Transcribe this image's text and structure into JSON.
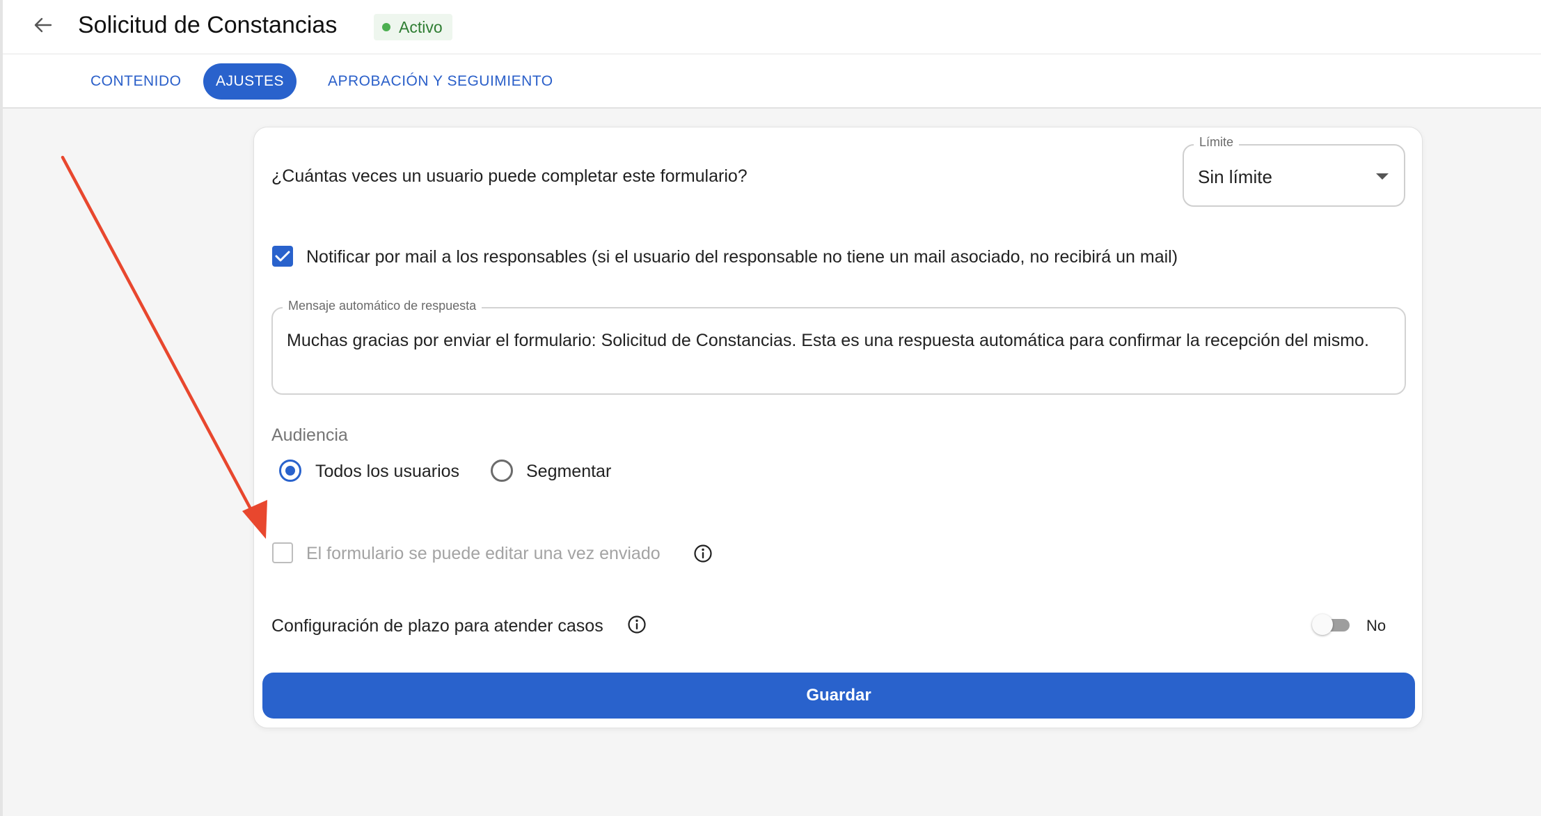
{
  "header": {
    "title": "Solicitud de Constancias",
    "status": "Activo",
    "status_color": "#4caf50"
  },
  "tabs": [
    {
      "label": "CONTENIDO",
      "active": false
    },
    {
      "label": "AJUSTES",
      "active": true
    },
    {
      "label": "APROBACIÓN Y SEGUIMIENTO",
      "active": false
    }
  ],
  "settings": {
    "completion_question": "¿Cuántas veces un usuario puede completar este formulario?",
    "limit": {
      "label": "Límite",
      "value": "Sin límite"
    },
    "notify": {
      "label": "Notificar por mail a los responsables (si el usuario del responsable no tiene un mail asociado, no recibirá un mail)",
      "checked": true
    },
    "auto_message": {
      "label": "Mensaje automático de respuesta",
      "value": "Muchas gracias por enviar el formulario: Solicitud de Constancias. Esta es una respuesta automática para confirmar la recepción del mismo."
    },
    "audience": {
      "label": "Audiencia",
      "options": [
        {
          "label": "Todos los usuarios",
          "selected": true
        },
        {
          "label": "Segmentar",
          "selected": false
        }
      ]
    },
    "editable": {
      "label": "El formulario se puede editar una vez enviado",
      "checked": false,
      "disabled": true
    },
    "deadline": {
      "label": "Configuración de plazo para atender casos",
      "toggle_label": "No",
      "enabled": false
    },
    "save_label": "Guardar"
  },
  "colors": {
    "primary": "#2962cc",
    "annotation_arrow": "#e8472e"
  }
}
